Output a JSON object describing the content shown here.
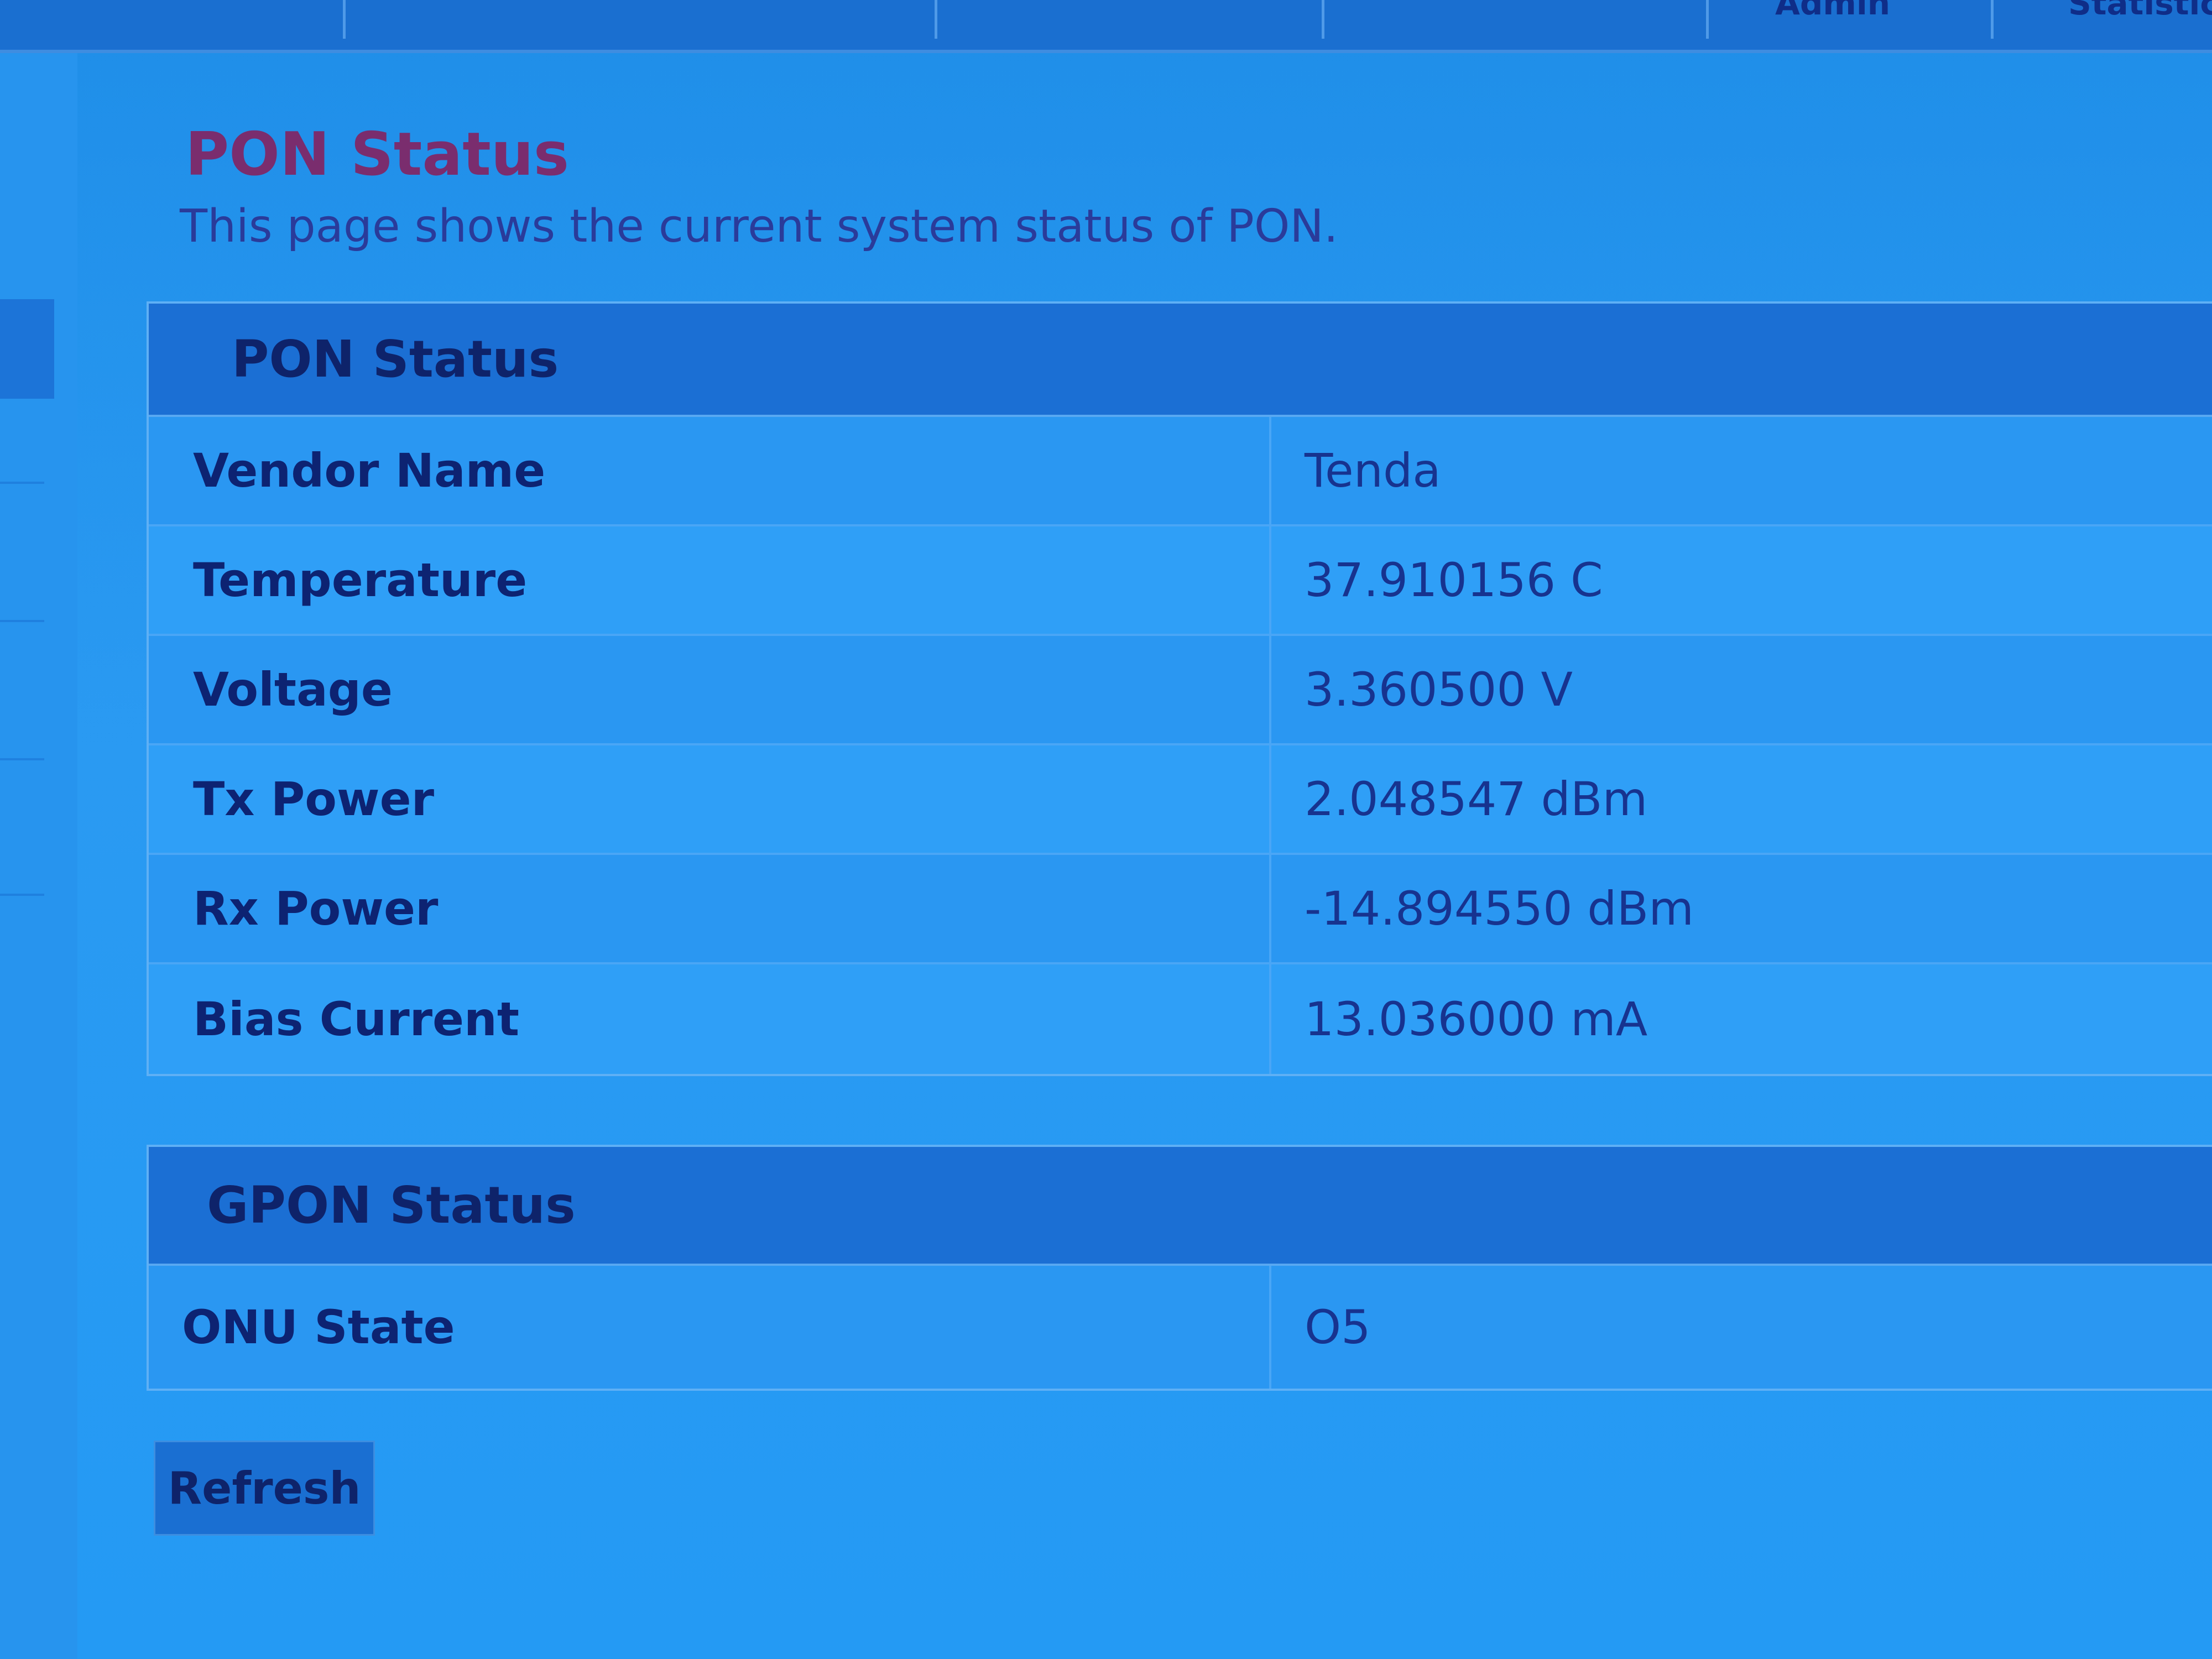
{
  "page": {
    "title": "PON Status",
    "description": "This page shows the current system status of PON."
  },
  "nav": {
    "items": [
      "Admin",
      "Statistics"
    ]
  },
  "pon_status": {
    "header": "PON Status",
    "rows": [
      {
        "label": "Vendor Name",
        "value": "Tenda"
      },
      {
        "label": "Temperature",
        "value": "37.910156 C"
      },
      {
        "label": "Voltage",
        "value": "3.360500 V"
      },
      {
        "label": "Tx Power",
        "value": "2.048547 dBm"
      },
      {
        "label": "Rx Power",
        "value": "-14.894550 dBm"
      },
      {
        "label": "Bias Current",
        "value": "13.036000 mA"
      }
    ]
  },
  "gpon_status": {
    "header": "GPON Status",
    "rows": [
      {
        "label": "ONU State",
        "value": "O5"
      }
    ]
  },
  "actions": {
    "refresh_label": "Refresh"
  },
  "colors": {
    "background": "#2a9af2",
    "header_bg": "#1b6fd4",
    "title": "#7a2d6e",
    "label_text": "#0d2372"
  }
}
